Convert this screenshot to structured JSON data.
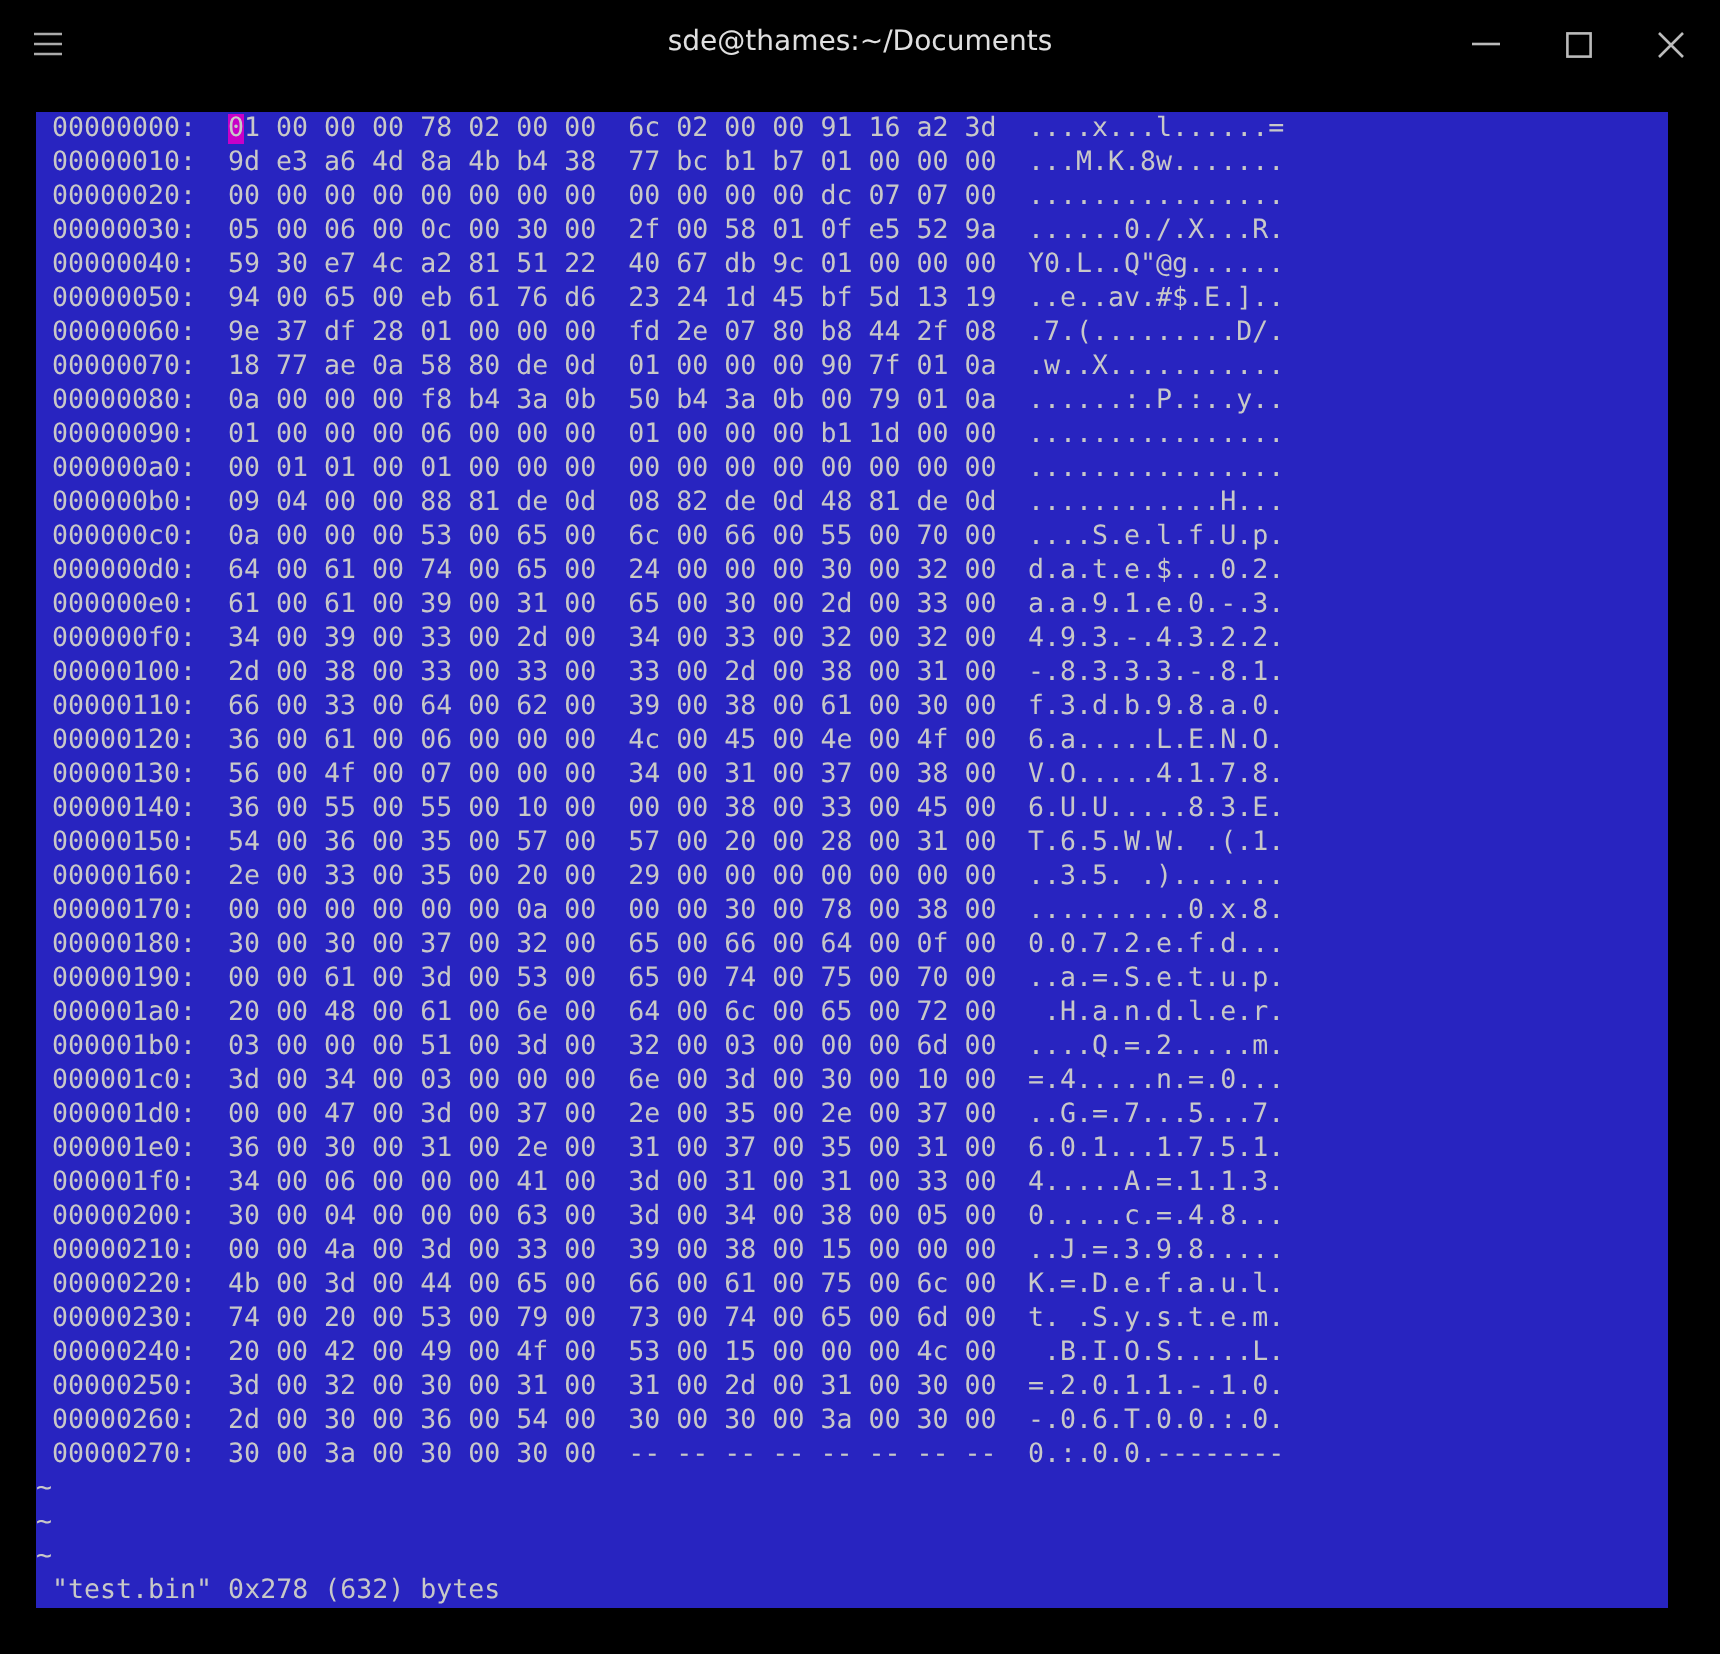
{
  "window": {
    "title": "sde@thames:~/Documents"
  },
  "rows": [
    {
      "offset": "00000000:",
      "hex": "01 00 00 00 78 02 00 00  6c 02 00 00 91 16 a2 3d",
      "ascii": "....x...l......=",
      "cursor": true
    },
    {
      "offset": "00000010:",
      "hex": "9d e3 a6 4d 8a 4b b4 38  77 bc b1 b7 01 00 00 00",
      "ascii": "...M.K.8w.......",
      "cursor": false
    },
    {
      "offset": "00000020:",
      "hex": "00 00 00 00 00 00 00 00  00 00 00 00 dc 07 07 00",
      "ascii": "................",
      "cursor": false
    },
    {
      "offset": "00000030:",
      "hex": "05 00 06 00 0c 00 30 00  2f 00 58 01 0f e5 52 9a",
      "ascii": "......0./.X...R.",
      "cursor": false
    },
    {
      "offset": "00000040:",
      "hex": "59 30 e7 4c a2 81 51 22  40 67 db 9c 01 00 00 00",
      "ascii": "Y0.L..Q\"@g......",
      "cursor": false
    },
    {
      "offset": "00000050:",
      "hex": "94 00 65 00 eb 61 76 d6  23 24 1d 45 bf 5d 13 19",
      "ascii": "..e..av.#$.E.]..",
      "cursor": false
    },
    {
      "offset": "00000060:",
      "hex": "9e 37 df 28 01 00 00 00  fd 2e 07 80 b8 44 2f 08",
      "ascii": ".7.(.........D/.",
      "cursor": false
    },
    {
      "offset": "00000070:",
      "hex": "18 77 ae 0a 58 80 de 0d  01 00 00 00 90 7f 01 0a",
      "ascii": ".w..X...........",
      "cursor": false
    },
    {
      "offset": "00000080:",
      "hex": "0a 00 00 00 f8 b4 3a 0b  50 b4 3a 0b 00 79 01 0a",
      "ascii": "......:.P.:..y..",
      "cursor": false
    },
    {
      "offset": "00000090:",
      "hex": "01 00 00 00 06 00 00 00  01 00 00 00 b1 1d 00 00",
      "ascii": "................",
      "cursor": false
    },
    {
      "offset": "000000a0:",
      "hex": "00 01 01 00 01 00 00 00  00 00 00 00 00 00 00 00",
      "ascii": "................",
      "cursor": false
    },
    {
      "offset": "000000b0:",
      "hex": "09 04 00 00 88 81 de 0d  08 82 de 0d 48 81 de 0d",
      "ascii": "............H...",
      "cursor": false
    },
    {
      "offset": "000000c0:",
      "hex": "0a 00 00 00 53 00 65 00  6c 00 66 00 55 00 70 00",
      "ascii": "....S.e.l.f.U.p.",
      "cursor": false
    },
    {
      "offset": "000000d0:",
      "hex": "64 00 61 00 74 00 65 00  24 00 00 00 30 00 32 00",
      "ascii": "d.a.t.e.$...0.2.",
      "cursor": false
    },
    {
      "offset": "000000e0:",
      "hex": "61 00 61 00 39 00 31 00  65 00 30 00 2d 00 33 00",
      "ascii": "a.a.9.1.e.0.-.3.",
      "cursor": false
    },
    {
      "offset": "000000f0:",
      "hex": "34 00 39 00 33 00 2d 00  34 00 33 00 32 00 32 00",
      "ascii": "4.9.3.-.4.3.2.2.",
      "cursor": false
    },
    {
      "offset": "00000100:",
      "hex": "2d 00 38 00 33 00 33 00  33 00 2d 00 38 00 31 00",
      "ascii": "-.8.3.3.3.-.8.1.",
      "cursor": false
    },
    {
      "offset": "00000110:",
      "hex": "66 00 33 00 64 00 62 00  39 00 38 00 61 00 30 00",
      "ascii": "f.3.d.b.9.8.a.0.",
      "cursor": false
    },
    {
      "offset": "00000120:",
      "hex": "36 00 61 00 06 00 00 00  4c 00 45 00 4e 00 4f 00",
      "ascii": "6.a.....L.E.N.O.",
      "cursor": false
    },
    {
      "offset": "00000130:",
      "hex": "56 00 4f 00 07 00 00 00  34 00 31 00 37 00 38 00",
      "ascii": "V.O.....4.1.7.8.",
      "cursor": false
    },
    {
      "offset": "00000140:",
      "hex": "36 00 55 00 55 00 10 00  00 00 38 00 33 00 45 00",
      "ascii": "6.U.U.....8.3.E.",
      "cursor": false
    },
    {
      "offset": "00000150:",
      "hex": "54 00 36 00 35 00 57 00  57 00 20 00 28 00 31 00",
      "ascii": "T.6.5.W.W. .(.1.",
      "cursor": false
    },
    {
      "offset": "00000160:",
      "hex": "2e 00 33 00 35 00 20 00  29 00 00 00 00 00 00 00",
      "ascii": "..3.5. .).......",
      "cursor": false
    },
    {
      "offset": "00000170:",
      "hex": "00 00 00 00 00 00 0a 00  00 00 30 00 78 00 38 00",
      "ascii": "..........0.x.8.",
      "cursor": false
    },
    {
      "offset": "00000180:",
      "hex": "30 00 30 00 37 00 32 00  65 00 66 00 64 00 0f 00",
      "ascii": "0.0.7.2.e.f.d...",
      "cursor": false
    },
    {
      "offset": "00000190:",
      "hex": "00 00 61 00 3d 00 53 00  65 00 74 00 75 00 70 00",
      "ascii": "..a.=.S.e.t.u.p.",
      "cursor": false
    },
    {
      "offset": "000001a0:",
      "hex": "20 00 48 00 61 00 6e 00  64 00 6c 00 65 00 72 00",
      "ascii": " .H.a.n.d.l.e.r.",
      "cursor": false
    },
    {
      "offset": "000001b0:",
      "hex": "03 00 00 00 51 00 3d 00  32 00 03 00 00 00 6d 00",
      "ascii": "....Q.=.2.....m.",
      "cursor": false
    },
    {
      "offset": "000001c0:",
      "hex": "3d 00 34 00 03 00 00 00  6e 00 3d 00 30 00 10 00",
      "ascii": "=.4.....n.=.0...",
      "cursor": false
    },
    {
      "offset": "000001d0:",
      "hex": "00 00 47 00 3d 00 37 00  2e 00 35 00 2e 00 37 00",
      "ascii": "..G.=.7...5...7.",
      "cursor": false
    },
    {
      "offset": "000001e0:",
      "hex": "36 00 30 00 31 00 2e 00  31 00 37 00 35 00 31 00",
      "ascii": "6.0.1...1.7.5.1.",
      "cursor": false
    },
    {
      "offset": "000001f0:",
      "hex": "34 00 06 00 00 00 41 00  3d 00 31 00 31 00 33 00",
      "ascii": "4.....A.=.1.1.3.",
      "cursor": false
    },
    {
      "offset": "00000200:",
      "hex": "30 00 04 00 00 00 63 00  3d 00 34 00 38 00 05 00",
      "ascii": "0.....c.=.4.8...",
      "cursor": false
    },
    {
      "offset": "00000210:",
      "hex": "00 00 4a 00 3d 00 33 00  39 00 38 00 15 00 00 00",
      "ascii": "..J.=.3.9.8.....",
      "cursor": false
    },
    {
      "offset": "00000220:",
      "hex": "4b 00 3d 00 44 00 65 00  66 00 61 00 75 00 6c 00",
      "ascii": "K.=.D.e.f.a.u.l.",
      "cursor": false
    },
    {
      "offset": "00000230:",
      "hex": "74 00 20 00 53 00 79 00  73 00 74 00 65 00 6d 00",
      "ascii": "t. .S.y.s.t.e.m.",
      "cursor": false
    },
    {
      "offset": "00000240:",
      "hex": "20 00 42 00 49 00 4f 00  53 00 15 00 00 00 4c 00",
      "ascii": " .B.I.O.S.....L.",
      "cursor": false
    },
    {
      "offset": "00000250:",
      "hex": "3d 00 32 00 30 00 31 00  31 00 2d 00 31 00 30 00",
      "ascii": "=.2.0.1.1.-.1.0.",
      "cursor": false
    },
    {
      "offset": "00000260:",
      "hex": "2d 00 30 00 36 00 54 00  30 00 30 00 3a 00 30 00",
      "ascii": "-.0.6.T.0.0.:.0.",
      "cursor": false
    },
    {
      "offset": "00000270:",
      "hex": "30 00 3a 00 30 00 30 00  -- -- -- -- -- -- -- --",
      "ascii": "0.:.0.0.--------",
      "cursor": false
    }
  ],
  "empty_lines": [
    "~",
    "~",
    "~"
  ],
  "status_line": "\"test.bin\" 0x278 (632) bytes"
}
